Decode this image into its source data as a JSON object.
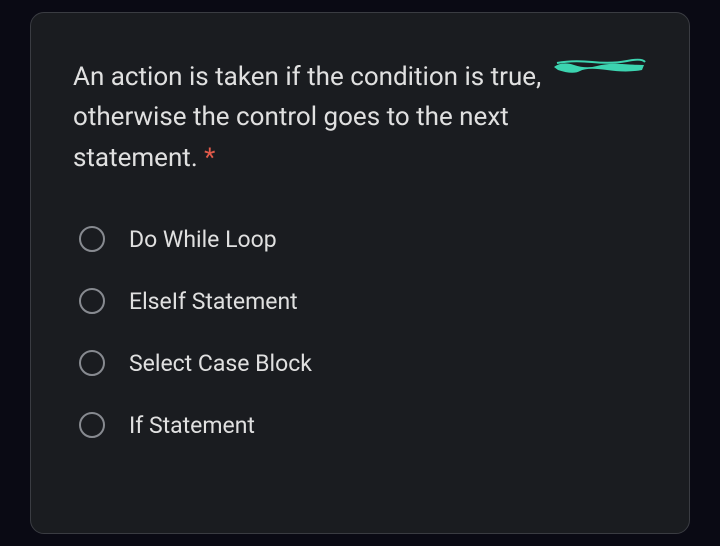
{
  "question": {
    "text": "An action is taken if the condition is true, otherwise the control goes to the next statement. ",
    "required_marker": "*"
  },
  "options": [
    {
      "label": "Do While Loop"
    },
    {
      "label": "ElseIf Statement"
    },
    {
      "label": "Select Case Block"
    },
    {
      "label": "If Statement"
    }
  ],
  "annotation": {
    "color": "#3cd4b0"
  }
}
